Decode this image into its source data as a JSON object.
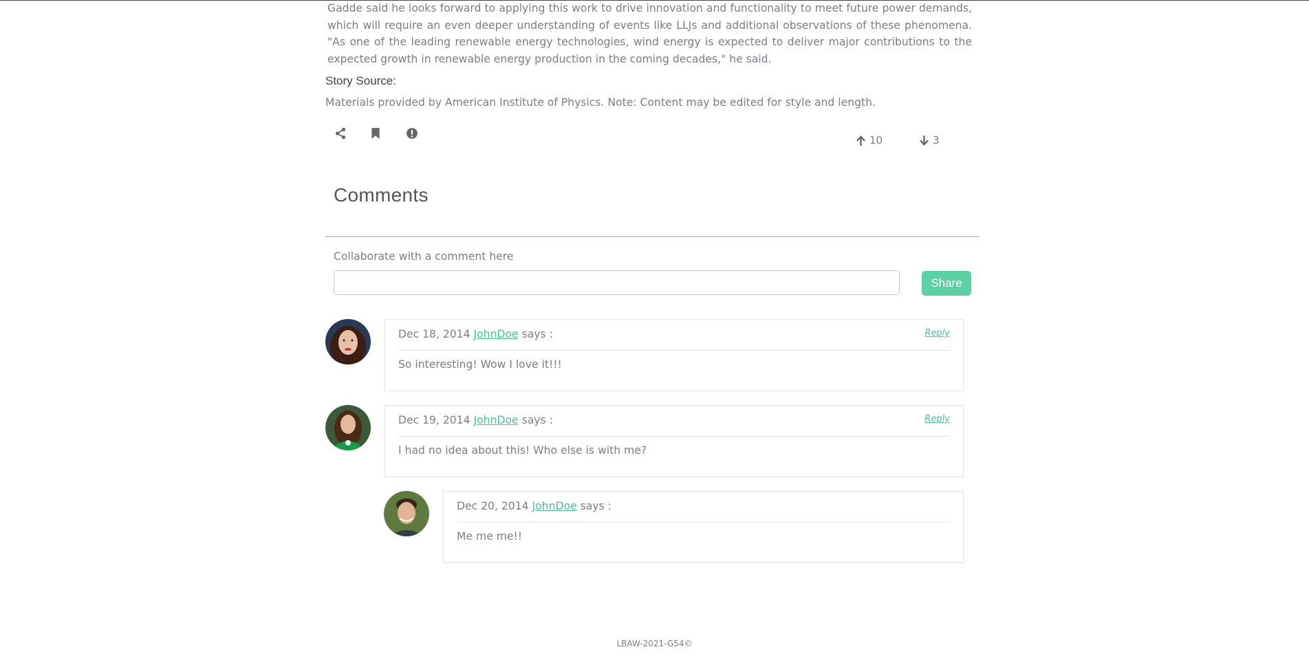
{
  "article": {
    "paragraph": "Gadde said he looks forward to applying this work to drive innovation and functionality to meet future power demands, which will require an even deeper understanding of events like LLJs and additional observations of these phenomena. \"As one of the leading renewable energy technologies, wind energy is expected to deliver major contributions to the expected growth in renewable energy production in the coming decades,\" he said.",
    "story_source_label": "Story Source:",
    "materials_text": "Materials provided by American Institute of Physics. Note: Content may be edited for style and length."
  },
  "actions": {
    "icons": [
      "share-icon",
      "bookmark-icon",
      "report-icon"
    ],
    "upvotes": "10",
    "downvotes": "3"
  },
  "comments_section": {
    "title": "Comments",
    "input_label": "Collaborate with a comment here",
    "input_value": "",
    "share_label": "Share",
    "items": [
      {
        "date": "Dec 18, 2014",
        "author": "JohnDoe",
        "says": "says :",
        "reply": "Reply",
        "text": "So interesting! Wow I love it!!!"
      },
      {
        "date": "Dec 19, 2014",
        "author": "JohnDoe",
        "says": "says :",
        "reply": "Reply",
        "text": "I had no idea about this! Who else is with me?"
      },
      {
        "date": "Dec 20, 2014",
        "author": "JohnDoe",
        "says": "says :",
        "text": "Me me me!!"
      }
    ]
  },
  "footer": {
    "text": "LBAW-2021-G54©"
  },
  "colors": {
    "accent": "#5cd0a2",
    "link": "#4cbf91",
    "text": "#7a7f85"
  }
}
